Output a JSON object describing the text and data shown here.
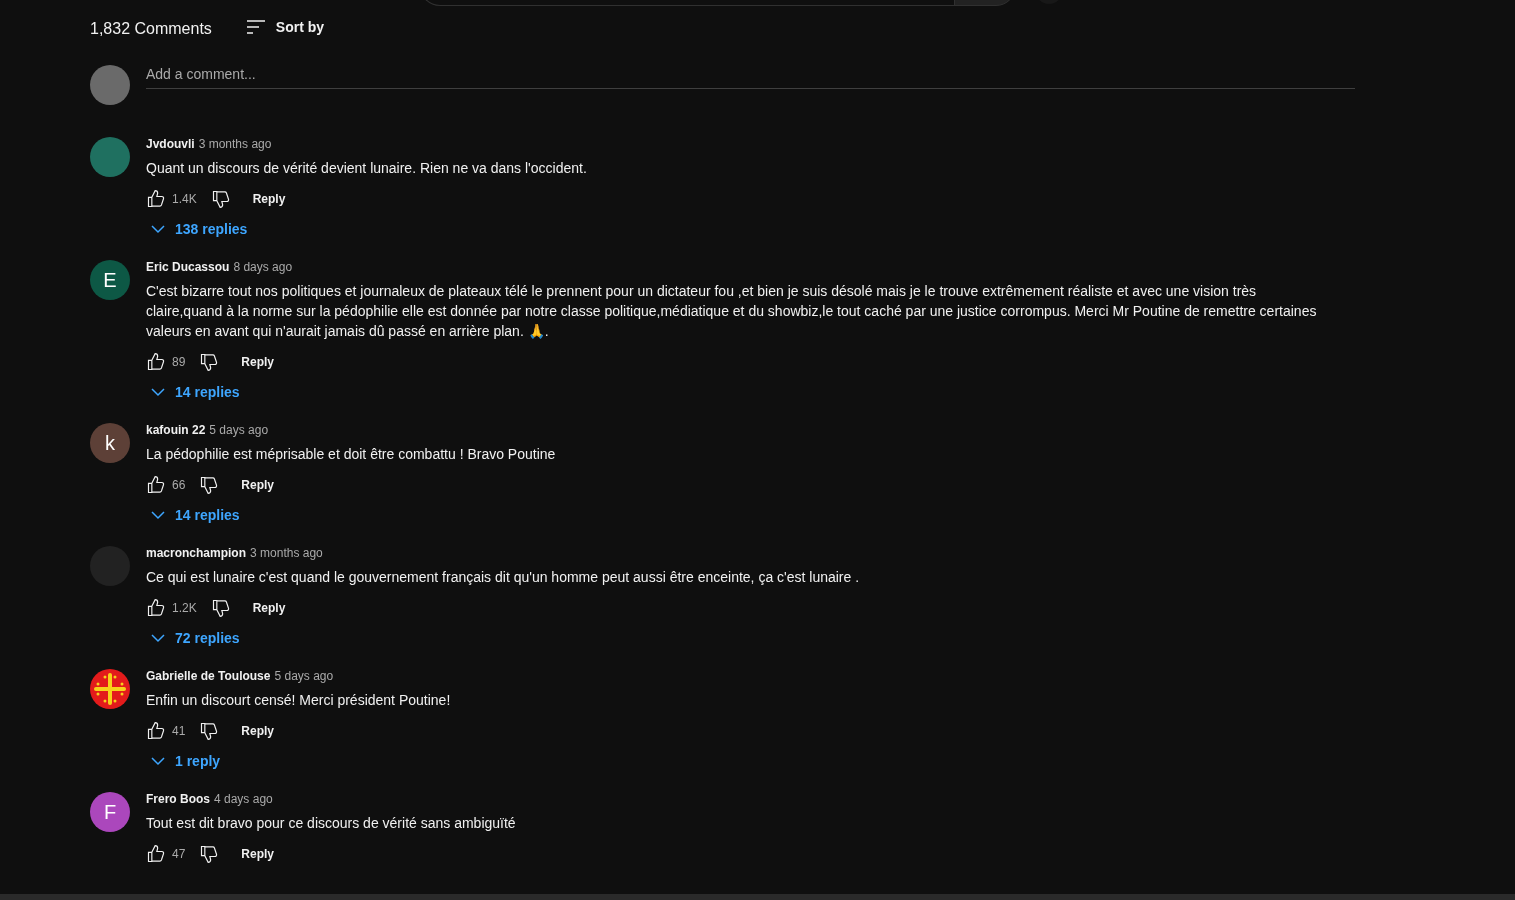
{
  "header": {
    "count": "1,832 Comments",
    "sort_label": "Sort by"
  },
  "composer": {
    "placeholder": "Add a comment..."
  },
  "comments": [
    {
      "author": "Jvdouvli",
      "time": "3 months ago",
      "text": "Quant un discours de vérité devient lunaire. Rien ne va dans l'occident.",
      "likes": "1.4K",
      "reply_label": "Reply",
      "replies": "138 replies",
      "avatar": {
        "kind": "plain",
        "color": "#1f7060"
      }
    },
    {
      "author": "Eric Ducassou",
      "time": "8 days ago",
      "text": "C'est bizarre tout nos politiques et journaleux de plateaux télé le prennent pour un dictateur fou ,et bien je suis désolé mais je le trouve extrêmement réaliste et avec une vision très claire,quand à la norme sur la pédophilie elle est donnée par notre classe politique,médiatique et du showbiz,le tout caché par une justice corrompus. Merci Mr Poutine de remettre certaines valeurs en avant qui n'aurait jamais dû passé en arrière plan. 🙏.",
      "likes": "89",
      "reply_label": "Reply",
      "replies": "14 replies",
      "avatar": {
        "kind": "letter",
        "letter": "E",
        "color": "#0d5845"
      }
    },
    {
      "author": "kafouin 22",
      "time": "5 days ago",
      "text": "La pédophilie est méprisable et doit être combattu ! Bravo Poutine",
      "likes": "66",
      "reply_label": "Reply",
      "replies": "14 replies",
      "avatar": {
        "kind": "letter",
        "letter": "k",
        "color": "#5d4037"
      }
    },
    {
      "author": "macronchampion",
      "time": "3 months ago",
      "text": "Ce qui est lunaire c'est quand le gouvernement français dit qu'un homme peut aussi être enceinte, ça c'est lunaire .",
      "likes": "1.2K",
      "reply_label": "Reply",
      "replies": "72 replies",
      "avatar": {
        "kind": "plain",
        "color": "#222222"
      }
    },
    {
      "author": "Gabrielle de Toulouse",
      "time": "5 days ago",
      "text": "Enfin un discourt censé! Merci président Poutine!",
      "likes": "41",
      "reply_label": "Reply",
      "replies": "1 reply",
      "avatar": {
        "kind": "cross",
        "color": "#e31b1b"
      }
    },
    {
      "author": "Frero Boos",
      "time": "4 days ago",
      "text": "Tout est dit bravo pour ce discours de vérité sans ambiguïté",
      "likes": "47",
      "reply_label": "Reply",
      "avatar": {
        "kind": "letter",
        "letter": "F",
        "color": "#ab47bc"
      }
    }
  ]
}
